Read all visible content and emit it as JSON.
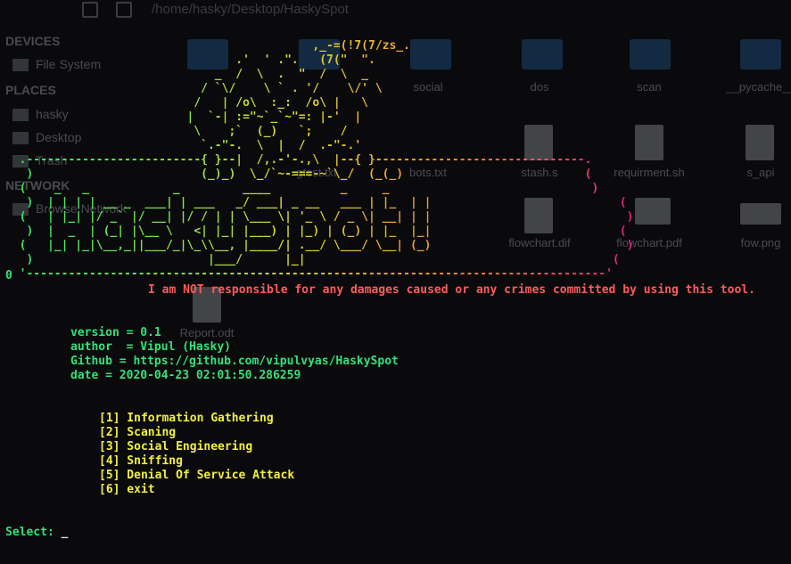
{
  "window": {
    "path": "/home/hasky/Desktop/HaskySpot"
  },
  "file_manager": {
    "sections": [
      {
        "title": "DEVICES",
        "items": [
          "File System"
        ]
      },
      {
        "title": "PLACES",
        "items": [
          "hasky",
          "Desktop",
          "Trash"
        ]
      },
      {
        "title": "NETWORK",
        "items": [
          "Browse Network"
        ]
      }
    ],
    "files_row1": [
      "",
      "",
      "social",
      "dos",
      "scan",
      "__pycache__"
    ],
    "files_row2": [
      "",
      "gtest.txt",
      "bots.txt",
      "stash.s",
      "requirment.sh",
      "s_api"
    ],
    "files_row3": [
      "",
      "",
      "",
      "flowchart.dif",
      "flowchart.pdf",
      "fow.png"
    ],
    "files_row4": [
      "Report.odt"
    ]
  },
  "terminal": {
    "banner": "                                            ,_-=(!7(7/zs_.\n                                 .'  ' .\".   (7(\"  \".\n                              _  /  \\  .  \"  /  \\  _\n                            / `\\/    \\ ` . '/    \\/' \\\n                           /   | /o\\  :_:  /o\\ |   \\\n                          |  `-| :=\"~`_`~\"=: |-'  |\n                           \\    ;`  (_)   `;    /\n                            `.-\"-.  \\  |  /  .-\"-.'\n  .-------------------------{ }--|  /,.-'-.,\\  |--{ }------------------------------.\n   )                        (_)_)  \\_/`~-===-~`\\_/  (_(_)                          (\n  (    _   _            _         ____          _     _                             )\n   )  | | | | __ _  ___| | ___   _/ ___| _ __   ___ | |_  | |                           (\n  (   | |_| |/ _` |/ __| |/ / | | \\___ \\| '_ \\ / _ \\| __| | |                            )\n   )  |  _  | (_| |\\__ \\   <| |_| |___) | |_) | (_) | |_  |_|                           (\n  (   |_| |_|\\__,_||___/_|\\_\\\\__, |____/| .__/ \\___/ \\__| (_)                            )\n   )                         |___/      |_|                                            (\n  '-----------------------------------------------------------------------------------'",
    "exit_code": "0",
    "warning": "I am NOT responsible for any damages caused or any crimes committed by using this tool.",
    "info": [
      "version = 0.1",
      "author  = Vipul (Hasky)",
      "Github = https://github.com/vipulvyas/HaskySpot",
      "date = 2020-04-23 02:01:50.286259"
    ],
    "menu": [
      "[1] Information Gathering",
      "[2] Scaning",
      "[3] Social Engineering",
      "[4] Sniffing",
      "[5] Denial Of Service Attack",
      "[6] exit"
    ],
    "prompt": "Select: ",
    "cursor": "_"
  },
  "colors": {
    "green": "#33e07a",
    "red": "#ff5b5b",
    "yellow": "#f2ef3c",
    "magenta": "#e0207a"
  }
}
